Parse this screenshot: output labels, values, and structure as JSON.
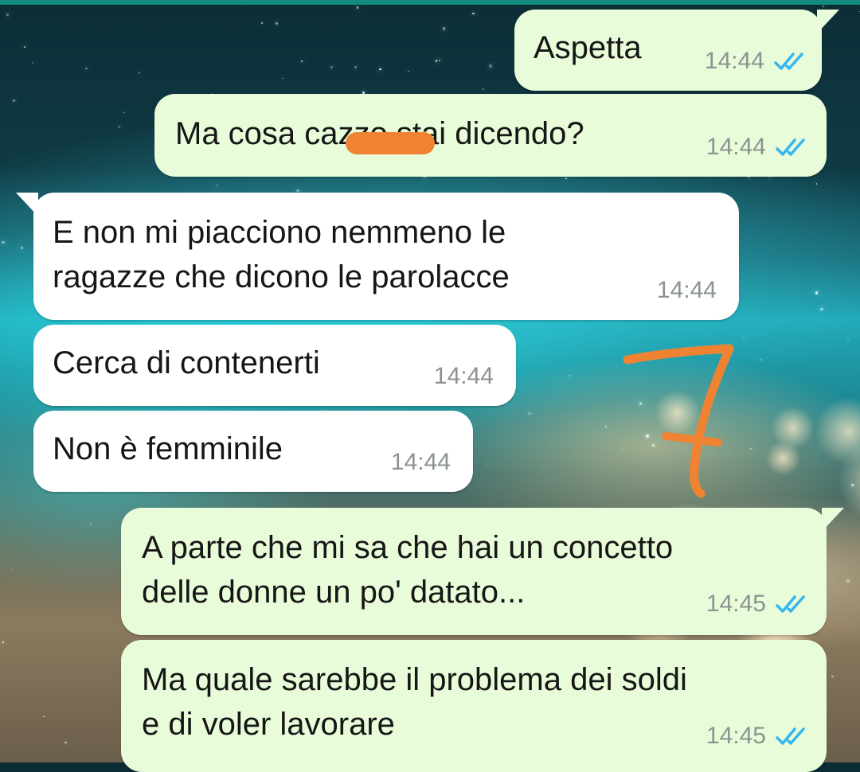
{
  "messages": [
    {
      "direction": "out",
      "text": "Aspetta",
      "time": "14:44",
      "read": true
    },
    {
      "direction": "out",
      "text_before": "Ma cosa c",
      "text_hidden": "azzo",
      "text_after": " stai dicendo?",
      "time": "14:44",
      "read": true
    },
    {
      "direction": "in",
      "line1": "E non mi piacciono nemmeno le",
      "line2": "ragazze che dicono le parolacce",
      "time": "14:44"
    },
    {
      "direction": "in",
      "text": "Cerca di contenerti",
      "time": "14:44"
    },
    {
      "direction": "in",
      "text": "Non è femminile",
      "time": "14:44"
    },
    {
      "direction": "out",
      "line1": "A parte che mi sa che hai un concetto",
      "line2": "delle donne un po' datato...",
      "time": "14:45",
      "read": true
    },
    {
      "direction": "out",
      "line1": "Ma quale sarebbe il problema dei soldi",
      "line2": "e di voler lavorare",
      "time": "14:45",
      "read": true
    }
  ],
  "annotation": {
    "glyph": "7",
    "color": "#f08331"
  },
  "colors": {
    "outgoing_bubble": "#e9fcd9",
    "incoming_bubble": "#ffffff",
    "read_ticks": "#34b7f1",
    "timestamp": "#8b938e",
    "redaction": "#f08331"
  }
}
